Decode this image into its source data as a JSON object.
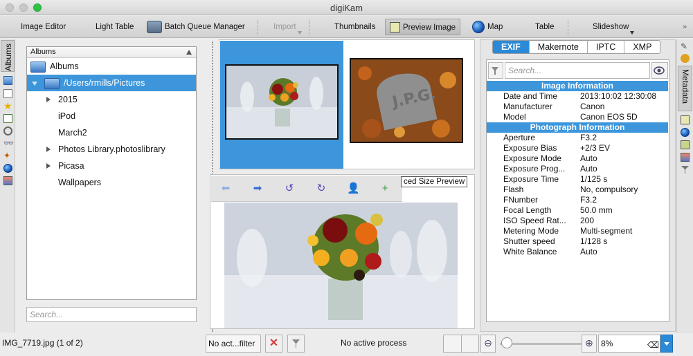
{
  "window": {
    "title": "digiKam"
  },
  "toolbar": {
    "image_editor": "Image Editor",
    "light_table": "Light Table",
    "batch_queue": "Batch Queue Manager",
    "import": "Import",
    "thumbnails": "Thumbnails",
    "preview_image": "Preview Image",
    "map": "Map",
    "table": "Table",
    "slideshow": "Slideshow"
  },
  "left_rail": {
    "tab_label": "Albums"
  },
  "albums": {
    "header": "Albums",
    "root": "Albums",
    "selected_path": "/Users/rmills/Pictures",
    "children": [
      {
        "label": "2015",
        "expandable": true
      },
      {
        "label": "iPod",
        "expandable": false
      },
      {
        "label": "March2",
        "expandable": false
      },
      {
        "label": "Photos Library.photoslibrary",
        "expandable": true
      },
      {
        "label": "Picasa",
        "expandable": true
      },
      {
        "label": "Wallpapers",
        "expandable": false
      }
    ],
    "search_placeholder": "Search..."
  },
  "preview": {
    "mode_label": "Reduced Size Preview",
    "mode_label_visible": "ced Size Preview"
  },
  "metadata": {
    "tabs": [
      "EXIF",
      "Makernote",
      "IPTC",
      "XMP"
    ],
    "active_tab": "EXIF",
    "search_placeholder": "Search...",
    "sections": [
      {
        "title": "Image Information",
        "rows": [
          {
            "label": "Date and Time",
            "value": "2013:10:02 12:30:08"
          },
          {
            "label": "Manufacturer",
            "value": "Canon"
          },
          {
            "label": "Model",
            "value": "Canon EOS 5D"
          }
        ]
      },
      {
        "title": "Photograph Information",
        "rows": [
          {
            "label": "Aperture",
            "value": "F3.2"
          },
          {
            "label": "Exposure Bias",
            "value": "+2/3 EV"
          },
          {
            "label": "Exposure Mode",
            "value": "Auto"
          },
          {
            "label": "Exposure Prog...",
            "value": "Auto"
          },
          {
            "label": "Exposure Time",
            "value": "1/125 s"
          },
          {
            "label": "Flash",
            "value": "No, compulsory"
          },
          {
            "label": "FNumber",
            "value": "F3.2"
          },
          {
            "label": "Focal Length",
            "value": "50.0 mm"
          },
          {
            "label": "ISO Speed Rat...",
            "value": "200"
          },
          {
            "label": "Metering Mode",
            "value": "Multi-segment"
          },
          {
            "label": "Shutter speed",
            "value": "1/128 s"
          },
          {
            "label": "White Balance",
            "value": "Auto"
          }
        ]
      }
    ]
  },
  "right_rail": {
    "tab_label": "Metadata"
  },
  "status": {
    "file_info": "IMG_7719.jpg (1 of 2)",
    "filter": "No act...filter",
    "process": "No active process",
    "zoom": "8%"
  },
  "colors": {
    "selection": "#3d96db",
    "accent": "#2a8ad8"
  }
}
